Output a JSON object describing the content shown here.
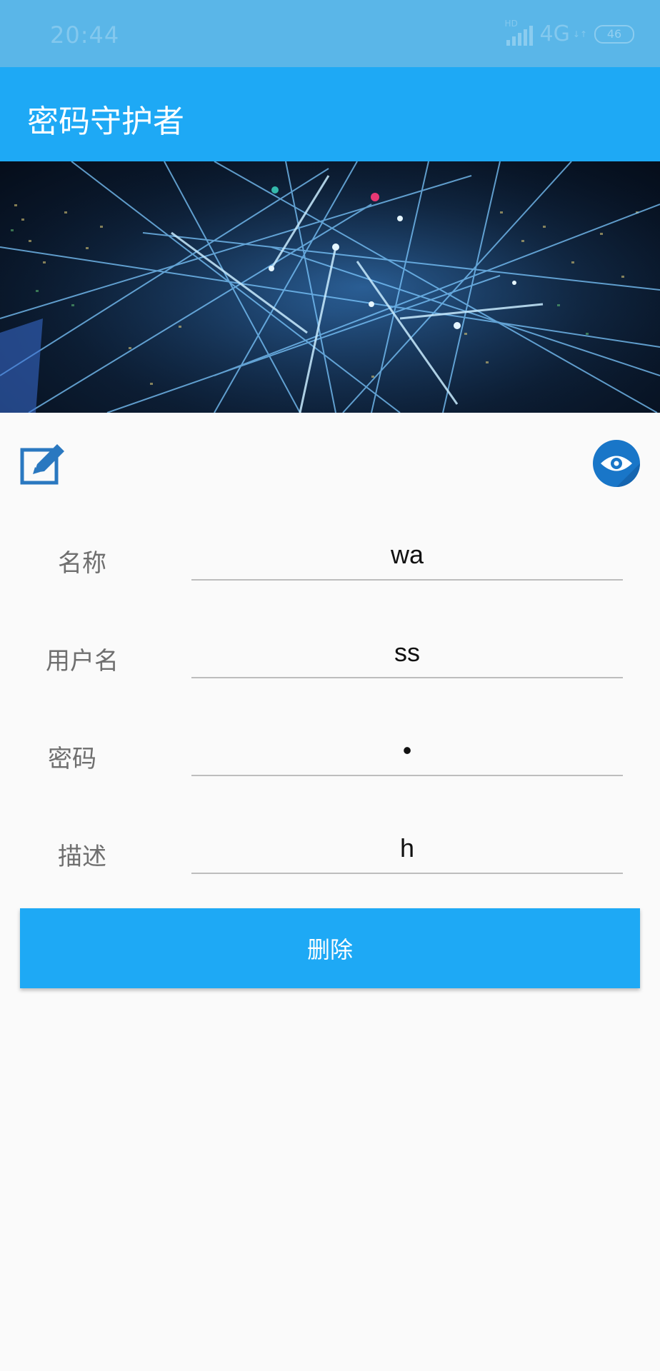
{
  "status_bar": {
    "time": "20:44",
    "hd_label": "HD",
    "network": "4G",
    "network_arrows": "↓↑",
    "battery": "46"
  },
  "app_bar": {
    "title": "密码守护者"
  },
  "icons": {
    "edit": "edit-icon",
    "visibility": "eye-icon"
  },
  "form": {
    "name": {
      "label": "名称",
      "value": "wa"
    },
    "username": {
      "label": "用户名",
      "value": "ss"
    },
    "password": {
      "label": "密码",
      "value": "•"
    },
    "description": {
      "label": "描述",
      "value": "h"
    }
  },
  "delete_button": {
    "label": "删除"
  },
  "colors": {
    "primary": "#1ea9f5",
    "status_bar": "#5ab6e8",
    "eye_button": "#1976c8",
    "edit_icon": "#2a78c0"
  }
}
